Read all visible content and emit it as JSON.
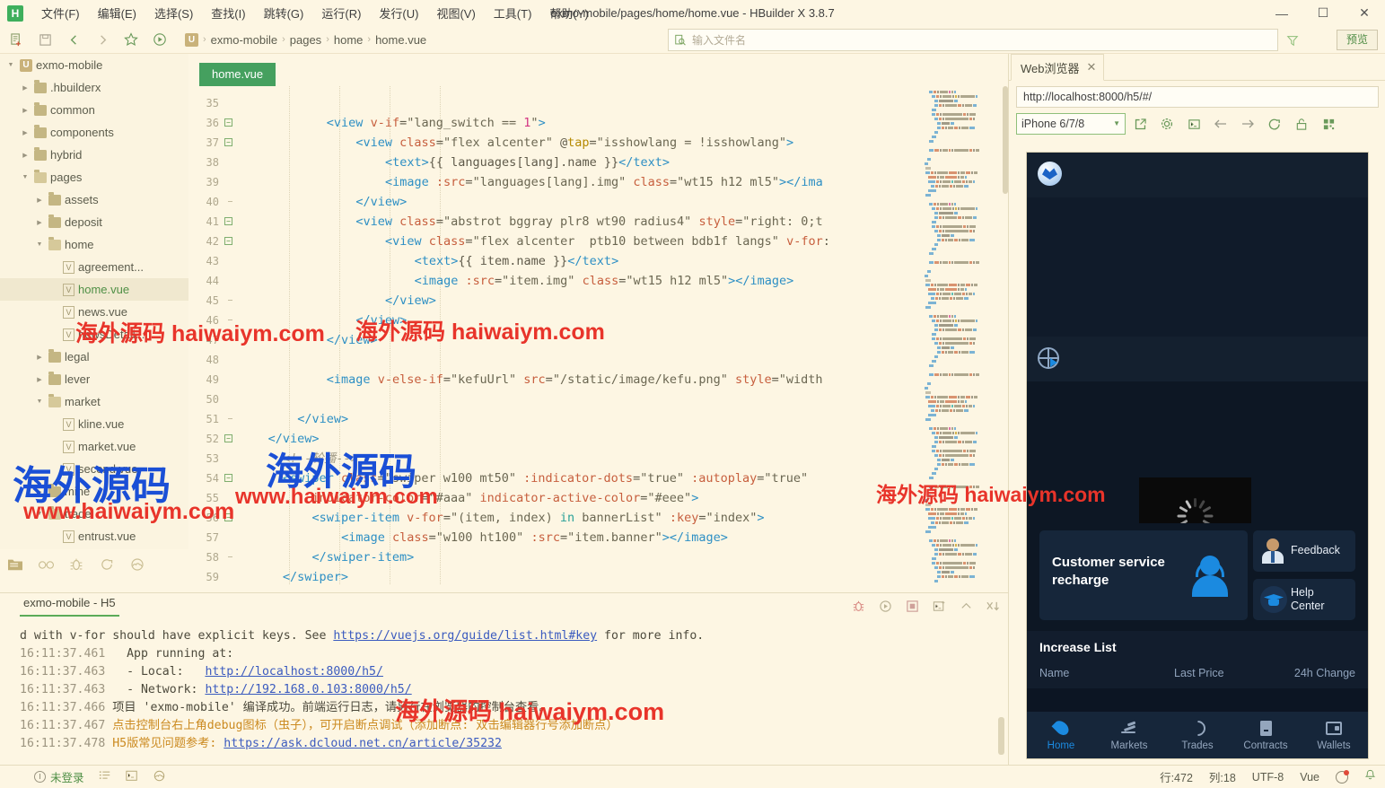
{
  "window": {
    "title": "exmo-mobile/pages/home/home.vue - HBuilder X 3.8.7",
    "minimize": "—",
    "maximize": "☐",
    "close": "✕"
  },
  "menu": {
    "logo": "H",
    "items": [
      "文件(F)",
      "编辑(E)",
      "选择(S)",
      "查找(I)",
      "跳转(G)",
      "运行(R)",
      "发行(U)",
      "视图(V)",
      "工具(T)",
      "帮助(Y)"
    ]
  },
  "toolbar": {
    "icons": [
      "new-file-icon",
      "save-icon",
      "back-icon",
      "forward-icon",
      "star-icon",
      "run-icon"
    ],
    "breadcrumb": {
      "badge": "U",
      "items": [
        "exmo-mobile",
        "pages",
        "home",
        "home.vue"
      ],
      "separator": "›"
    },
    "search_placeholder": "输入文件名",
    "preview_label": "预览"
  },
  "sidebar": {
    "tree": [
      {
        "label": "exmo-mobile",
        "indent": 0,
        "arrow": "⌄",
        "icon": "u",
        "active": false
      },
      {
        "label": ".hbuilderx",
        "indent": 1,
        "arrow": "›",
        "icon": "folder",
        "active": false
      },
      {
        "label": "common",
        "indent": 1,
        "arrow": "›",
        "icon": "folder",
        "active": false
      },
      {
        "label": "components",
        "indent": 1,
        "arrow": "›",
        "icon": "folder",
        "active": false
      },
      {
        "label": "hybrid",
        "indent": 1,
        "arrow": "›",
        "icon": "folder",
        "active": false
      },
      {
        "label": "pages",
        "indent": 1,
        "arrow": "⌄",
        "icon": "folder-open",
        "active": false
      },
      {
        "label": "assets",
        "indent": 2,
        "arrow": "›",
        "icon": "folder",
        "active": false
      },
      {
        "label": "deposit",
        "indent": 2,
        "arrow": "›",
        "icon": "folder",
        "active": false
      },
      {
        "label": "home",
        "indent": 2,
        "arrow": "⌄",
        "icon": "folder-open",
        "active": false
      },
      {
        "label": "agreement...",
        "indent": 3,
        "arrow": "",
        "icon": "vue",
        "active": false
      },
      {
        "label": "home.vue",
        "indent": 3,
        "arrow": "",
        "icon": "vue",
        "active": true
      },
      {
        "label": "news.vue",
        "indent": 3,
        "arrow": "",
        "icon": "vue",
        "active": false
      },
      {
        "label": "newsDetail....",
        "indent": 3,
        "arrow": "",
        "icon": "vue",
        "active": false
      },
      {
        "label": "legal",
        "indent": 2,
        "arrow": "›",
        "icon": "folder",
        "active": false
      },
      {
        "label": "lever",
        "indent": 2,
        "arrow": "›",
        "icon": "folder",
        "active": false
      },
      {
        "label": "market",
        "indent": 2,
        "arrow": "⌄",
        "icon": "folder-open",
        "active": false
      },
      {
        "label": "kline.vue",
        "indent": 3,
        "arrow": "",
        "icon": "vue",
        "active": false
      },
      {
        "label": "market.vue",
        "indent": 3,
        "arrow": "",
        "icon": "vue",
        "active": false
      },
      {
        "label": "second.vue",
        "indent": 3,
        "arrow": "",
        "icon": "vue",
        "active": false
      },
      {
        "label": "mine",
        "indent": 2,
        "arrow": "›",
        "icon": "folder",
        "active": false
      },
      {
        "label": "trade",
        "indent": 2,
        "arrow": "⌄",
        "icon": "folder-open",
        "active": false
      },
      {
        "label": "entrust.vue",
        "indent": 3,
        "arrow": "",
        "icon": "vue",
        "active": false
      }
    ],
    "bottom_tabs": [
      "project-icon",
      "search-icon",
      "debug-icon",
      "sync-icon",
      "cloud-icon"
    ]
  },
  "editor": {
    "tab_label": "home.vue",
    "lines": [
      {
        "n": "35",
        "fold": "",
        "indent": 0,
        "tokens": []
      },
      {
        "n": "36",
        "fold": "-",
        "indent": 12,
        "tokens": [
          {
            "t": "<view ",
            "c": "tg"
          },
          {
            "t": "v-if",
            "c": "at"
          },
          {
            "t": "=",
            "c": "op"
          },
          {
            "t": "\"lang_switch == ",
            "c": "st"
          },
          {
            "t": "1",
            "c": "nm"
          },
          {
            "t": "\"",
            "c": "st"
          },
          {
            "t": ">",
            "c": "tg"
          }
        ]
      },
      {
        "n": "37",
        "fold": "-",
        "indent": 16,
        "tokens": [
          {
            "t": "<view ",
            "c": "tg"
          },
          {
            "t": "class",
            "c": "at"
          },
          {
            "t": "=",
            "c": "op"
          },
          {
            "t": "\"flex alcenter\" ",
            "c": "st"
          },
          {
            "t": "@",
            "c": "op"
          },
          {
            "t": "tap",
            "c": "kw"
          },
          {
            "t": "=",
            "c": "op"
          },
          {
            "t": "\"isshowlang = !isshowlang\"",
            "c": "st"
          },
          {
            "t": ">",
            "c": "tg"
          }
        ]
      },
      {
        "n": "38",
        "fold": "",
        "indent": 20,
        "tokens": [
          {
            "t": "<text>",
            "c": "tg"
          },
          {
            "t": "{{ languages[lang].name }}",
            "c": "vl"
          },
          {
            "t": "</text>",
            "c": "tg"
          }
        ]
      },
      {
        "n": "39",
        "fold": "",
        "indent": 20,
        "tokens": [
          {
            "t": "<image ",
            ":c": "tg",
            "c": "tg"
          },
          {
            "t": ":src",
            "c": "at"
          },
          {
            "t": "=",
            "c": "op"
          },
          {
            "t": "\"languages[lang].img\" ",
            "c": "st"
          },
          {
            "t": "class",
            "c": "at"
          },
          {
            "t": "=",
            "c": "op"
          },
          {
            "t": "\"wt15 h12 ml5\"",
            "c": "st"
          },
          {
            "t": "></ima",
            "c": "tg"
          }
        ]
      },
      {
        "n": "40",
        "fold": "|",
        "indent": 16,
        "tokens": [
          {
            "t": "</view>",
            "c": "tg"
          }
        ]
      },
      {
        "n": "41",
        "fold": "-",
        "indent": 16,
        "tokens": [
          {
            "t": "<view ",
            "c": "tg"
          },
          {
            "t": "class",
            "c": "at"
          },
          {
            "t": "=",
            "c": "op"
          },
          {
            "t": "\"abstrot bggray plr8 wt90 radius4\" ",
            "c": "st"
          },
          {
            "t": "style",
            "c": "at"
          },
          {
            "t": "=",
            "c": "op"
          },
          {
            "t": "\"right: 0;t",
            "c": "st"
          }
        ]
      },
      {
        "n": "42",
        "fold": "-",
        "indent": 20,
        "tokens": [
          {
            "t": "<view ",
            "c": "tg"
          },
          {
            "t": "class",
            "c": "at"
          },
          {
            "t": "=",
            "c": "op"
          },
          {
            "t": "\"flex alcenter  ptb10 between bdb1f langs\" ",
            "c": "st"
          },
          {
            "t": "v-for",
            "c": "at"
          },
          {
            "t": ":",
            "c": "op"
          }
        ]
      },
      {
        "n": "43",
        "fold": "",
        "indent": 24,
        "tokens": [
          {
            "t": "<text>",
            "c": "tg"
          },
          {
            "t": "{{ item.name }}",
            "c": "vl"
          },
          {
            "t": "</text>",
            "c": "tg"
          }
        ]
      },
      {
        "n": "44",
        "fold": "",
        "indent": 24,
        "tokens": [
          {
            "t": "<image ",
            "c": "tg"
          },
          {
            "t": ":src",
            "c": "at"
          },
          {
            "t": "=",
            "c": "op"
          },
          {
            "t": "\"item.img\" ",
            "c": "st"
          },
          {
            "t": "class",
            "c": "at"
          },
          {
            "t": "=",
            "c": "op"
          },
          {
            "t": "\"wt15 h12 ml5\"",
            "c": "st"
          },
          {
            "t": "></image>",
            "c": "tg"
          }
        ]
      },
      {
        "n": "45",
        "fold": "|",
        "indent": 20,
        "tokens": [
          {
            "t": "</view>",
            "c": "tg"
          }
        ]
      },
      {
        "n": "46",
        "fold": "|",
        "indent": 16,
        "tokens": [
          {
            "t": "</view>",
            "c": "tg"
          }
        ]
      },
      {
        "n": "47",
        "fold": "|",
        "indent": 12,
        "tokens": [
          {
            "t": "</view>",
            "c": "tg"
          }
        ]
      },
      {
        "n": "48",
        "fold": "",
        "indent": 0,
        "tokens": []
      },
      {
        "n": "49",
        "fold": "",
        "indent": 12,
        "tokens": [
          {
            "t": "<image ",
            "c": "tg"
          },
          {
            "t": "v-else-if",
            "c": "at"
          },
          {
            "t": "=",
            "c": "op"
          },
          {
            "t": "\"kefuUrl\" ",
            "c": "st"
          },
          {
            "t": "src",
            "c": "at"
          },
          {
            "t": "=",
            "c": "op"
          },
          {
            "t": "\"/static/image/kefu.png\" ",
            "c": "st"
          },
          {
            "t": "style",
            "c": "at"
          },
          {
            "t": "=",
            "c": "op"
          },
          {
            "t": "\"width",
            "c": "st"
          }
        ]
      },
      {
        "n": "50",
        "fold": "",
        "indent": 0,
        "tokens": []
      },
      {
        "n": "51",
        "fold": "|",
        "indent": 8,
        "tokens": [
          {
            "t": "</view>",
            "c": "tg"
          }
        ]
      },
      {
        "n": "52",
        "fold": "-",
        "indent": 4,
        "tokens": [
          {
            "t": "</view>",
            "c": "tg"
          }
        ]
      },
      {
        "n": "53",
        "fold": "",
        "indent": 6,
        "tokens": [
          {
            "t": "<!--轮播-->",
            "c": "cm"
          }
        ]
      },
      {
        "n": "54",
        "fold": "-",
        "indent": 6,
        "tokens": [
          {
            "t": "<swiper ",
            "c": "tg"
          },
          {
            "t": "class",
            "c": "at"
          },
          {
            "t": "=",
            "c": "op"
          },
          {
            "t": "\"swiper w100 mt50\" ",
            "c": "st"
          },
          {
            "t": ":indicator-dots",
            "c": "at"
          },
          {
            "t": "=",
            "c": "op"
          },
          {
            "t": "\"true\" ",
            "c": "st"
          },
          {
            "t": ":autoplay",
            "c": "at"
          },
          {
            "t": "=",
            "c": "op"
          },
          {
            "t": "\"true\"",
            "c": "st"
          }
        ]
      },
      {
        "n": "55",
        "fold": "",
        "indent": 10,
        "tokens": [
          {
            "t": "indicator-color",
            "c": "at"
          },
          {
            "t": "=",
            "c": "op"
          },
          {
            "t": "\"#aaa\" ",
            "c": "st"
          },
          {
            "t": "indicator-active-color",
            "c": "at"
          },
          {
            "t": "=",
            "c": "op"
          },
          {
            "t": "\"#eee\"",
            "c": "st"
          },
          {
            "t": ">",
            "c": "tg"
          }
        ]
      },
      {
        "n": "56",
        "fold": "-",
        "indent": 10,
        "tokens": [
          {
            "t": "<swiper-item ",
            "c": "tg"
          },
          {
            "t": "v-for",
            "c": "at"
          },
          {
            "t": "=",
            "c": "op"
          },
          {
            "t": "\"(item, index) ",
            "c": "st"
          },
          {
            "t": "in",
            "c": "gr"
          },
          {
            "t": " bannerList\" ",
            "c": "st"
          },
          {
            "t": ":key",
            "c": "at"
          },
          {
            "t": "=",
            "c": "op"
          },
          {
            "t": "\"index\"",
            "c": "st"
          },
          {
            "t": ">",
            "c": "tg"
          }
        ]
      },
      {
        "n": "57",
        "fold": "",
        "indent": 14,
        "tokens": [
          {
            "t": "<image ",
            "c": "tg"
          },
          {
            "t": "class",
            "c": "at"
          },
          {
            "t": "=",
            "c": "op"
          },
          {
            "t": "\"w100 ht100\" ",
            "c": "st"
          },
          {
            "t": ":src",
            "c": "at"
          },
          {
            "t": "=",
            "c": "op"
          },
          {
            "t": "\"item.banner\"",
            "c": "st"
          },
          {
            "t": "></image>",
            "c": "tg"
          }
        ]
      },
      {
        "n": "58",
        "fold": "|",
        "indent": 10,
        "tokens": [
          {
            "t": "</swiper-item>",
            "c": "tg"
          }
        ]
      },
      {
        "n": "59",
        "fold": "",
        "indent": 6,
        "tokens": [
          {
            "t": "</swiper>",
            "c": "tg"
          }
        ]
      }
    ]
  },
  "console": {
    "tab_label": "exmo-mobile - H5",
    "tools": [
      "debug-bug-icon",
      "rerun-icon",
      "stop-icon",
      "terminal-icon",
      "collapse-icon",
      "clear-icon"
    ],
    "lines": [
      [
        {
          "t": "d with v-for should have explicit keys. See ",
          "c": "cn"
        },
        {
          "t": "https://vuejs.org/guide/list.html#key",
          "c": "lnk"
        },
        {
          "t": " for more info.",
          "c": "cn"
        }
      ],
      [
        {
          "t": "16:11:37.461 ",
          "c": "ts"
        },
        {
          "t": "  App running at:",
          "c": "cn"
        }
      ],
      [
        {
          "t": "16:11:37.463 ",
          "c": "ts"
        },
        {
          "t": "  - Local:   ",
          "c": "cn"
        },
        {
          "t": "http://localhost:8000/h5/",
          "c": "lnk"
        }
      ],
      [
        {
          "t": "16:11:37.463 ",
          "c": "ts"
        },
        {
          "t": "  - Network: ",
          "c": "cn"
        },
        {
          "t": "http://192.168.0.103:8000/h5/",
          "c": "lnk"
        }
      ],
      [
        {
          "t": "16:11:37.466 ",
          "c": "ts"
        },
        {
          "t": "项目 'exmo-mobile' 编译成功。前端运行日志，请另行在浏览器的控制台查看。",
          "c": "cn"
        }
      ],
      [
        {
          "t": "16:11:37.467 ",
          "c": "ts"
        },
        {
          "t": "点击控制台右上角debug图标（虫子），可开启断点调试（添加断点: 双击编辑器行号添加断点）",
          "c": "warn"
        }
      ],
      [
        {
          "t": "16:11:37.478 ",
          "c": "ts"
        },
        {
          "t": "H5版常见问题参考: ",
          "c": "warn"
        },
        {
          "t": "https://ask.dcloud.net.cn/article/35232",
          "c": "lnk"
        }
      ]
    ]
  },
  "browser": {
    "tab_label": "Web浏览器",
    "tab_close": "✕",
    "url": "http://localhost:8000/h5/#/",
    "device": "iPhone 6/7/8",
    "icons": [
      "popout-icon",
      "settings-gear-icon",
      "console-icon",
      "back-arrow-icon",
      "forward-arrow-icon",
      "reload-icon",
      "unlock-icon",
      "grid-icon"
    ]
  },
  "preview": {
    "logo": "app-logo-icon",
    "globe_icon": "globe-icon",
    "cards": {
      "customer_service": "Customer service recharge",
      "feedback": "Feedback",
      "help_center": "Help\nCenter"
    },
    "list": {
      "title": "Increase List",
      "columns": [
        "Name",
        "Last Price",
        "24h Change"
      ]
    },
    "tabbar": [
      {
        "label": "Home",
        "icon": "flame-icon",
        "active": true
      },
      {
        "label": "Markets",
        "icon": "bars-icon",
        "active": false
      },
      {
        "label": "Trades",
        "icon": "swap-icon",
        "active": false
      },
      {
        "label": "Contracts",
        "icon": "document-icon",
        "active": false
      },
      {
        "label": "Wallets",
        "icon": "wallet-icon",
        "active": false
      }
    ]
  },
  "statusbar": {
    "login": "未登录",
    "icons": [
      "outline-icon",
      "terminal-icon",
      "cloud-icon"
    ],
    "line": "行:472",
    "column": "列:18",
    "encoding": "UTF-8",
    "language": "Vue",
    "update_icon": "update-badge-icon",
    "bell_icon": "bell-icon"
  },
  "watermarks": {
    "cn": "海外源码",
    "domain": "haiwaiym.com",
    "www": "www.haiwaiym.com"
  },
  "colors": {
    "bg": "#fdf6e3",
    "accent_green": "#45a05f",
    "tag_blue": "#2d8fc4",
    "attr_orange": "#c75f3e",
    "phone_bg": "#0d1724",
    "phone_blue": "#1b8ae0"
  }
}
